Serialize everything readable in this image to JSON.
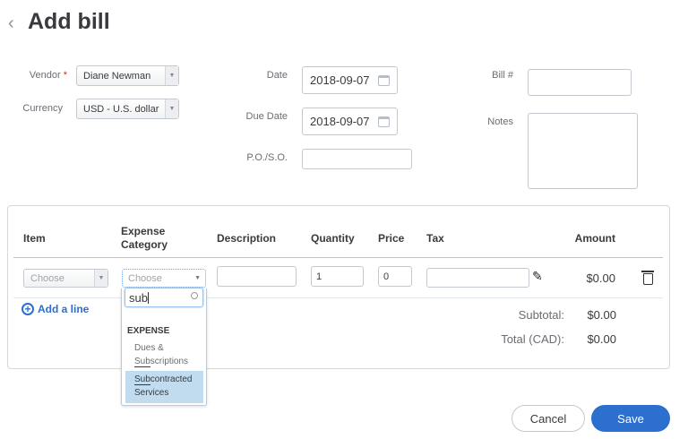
{
  "header": {
    "title": "Add bill",
    "back_icon": "chevron-left-icon"
  },
  "form": {
    "vendor": {
      "label": "Vendor",
      "required_mark": "*",
      "value": "Diane Newman"
    },
    "currency": {
      "label": "Currency",
      "value": "USD - U.S. dollar"
    },
    "date": {
      "label": "Date",
      "value": "2018-09-07"
    },
    "due_date": {
      "label": "Due Date",
      "value": "2018-09-07"
    },
    "po_so": {
      "label": "P.O./S.O.",
      "value": ""
    },
    "bill_no": {
      "label": "Bill #",
      "value": ""
    },
    "notes": {
      "label": "Notes",
      "value": ""
    }
  },
  "table": {
    "headers": {
      "item": "Item",
      "expense_category_1": "Expense",
      "expense_category_2": "Category",
      "description": "Description",
      "quantity": "Quantity",
      "price": "Price",
      "tax": "Tax",
      "amount": "Amount"
    },
    "row": {
      "item_placeholder": "Choose",
      "category_placeholder": "Choose",
      "description": "",
      "quantity": "1",
      "price": "0",
      "tax": "",
      "amount": "$0.00"
    },
    "add_line": "Add a line",
    "subtotal_label": "Subtotal:",
    "subtotal": "$0.00",
    "total_label": "Total (CAD):",
    "total": "$0.00"
  },
  "dropdown": {
    "search_value": "sub",
    "group": "EXPENSE",
    "options": [
      {
        "pre": "Dues & ",
        "match": "Sub",
        "post": "scriptions"
      },
      {
        "pre": "",
        "match": "Sub",
        "post": "contracted Services",
        "highlighted": true
      }
    ]
  },
  "footer": {
    "cancel": "Cancel",
    "save": "Save"
  },
  "colors": {
    "accent": "#2c6fcf",
    "highlight": "#c1dcef",
    "required": "#d52b1e"
  }
}
